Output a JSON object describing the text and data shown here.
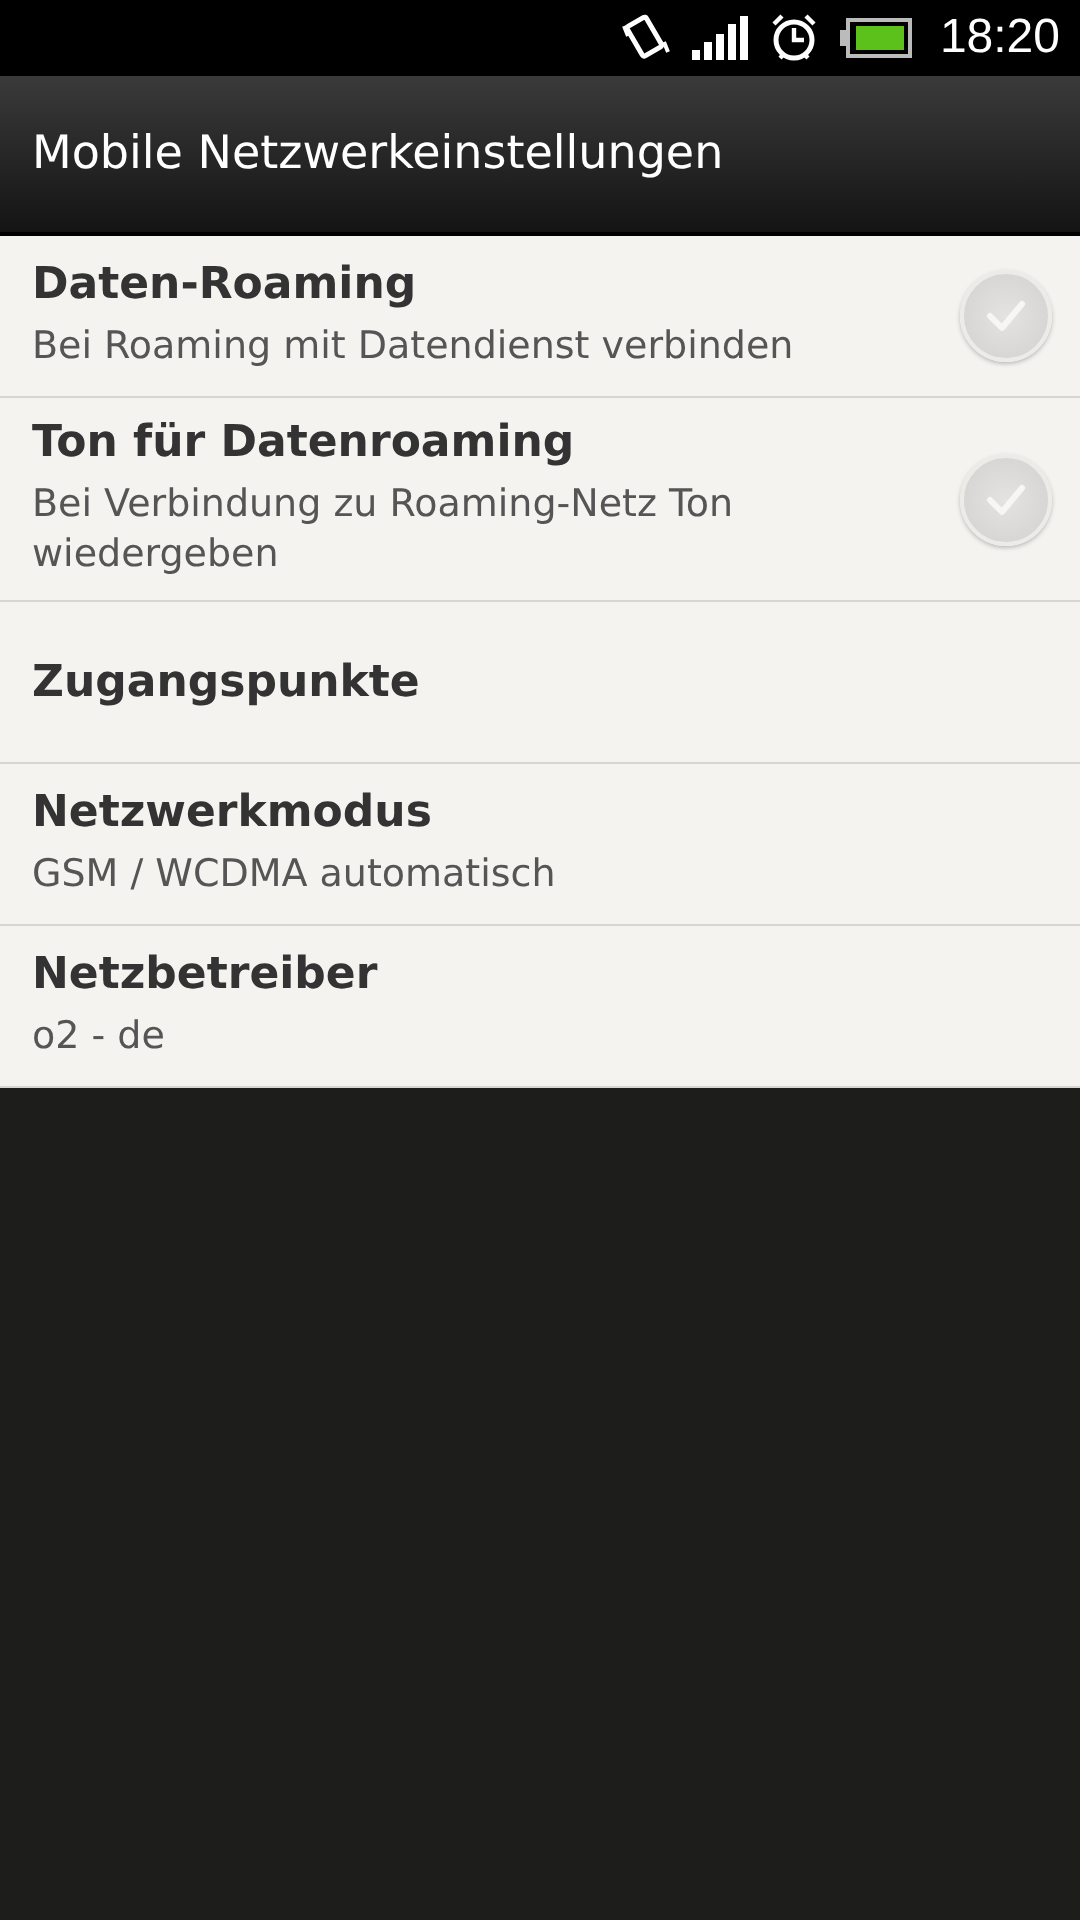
{
  "status_bar": {
    "time": "18:20"
  },
  "title_bar": {
    "title": "Mobile Netzwerkeinstellungen"
  },
  "settings": [
    {
      "kind": "checkbox",
      "title": "Daten-Roaming",
      "summary": "Bei Roaming mit Datendienst verbinden",
      "checked": false
    },
    {
      "kind": "checkbox",
      "title": "Ton für Datenroaming",
      "summary": "Bei Verbindung zu Roaming-Netz Ton wiedergeben",
      "checked": false
    },
    {
      "kind": "text",
      "title": "Zugangspunkte"
    },
    {
      "kind": "text",
      "title": "Netzwerkmodus",
      "summary": "GSM / WCDMA automatisch"
    },
    {
      "kind": "text",
      "title": "Netzbetreiber",
      "summary": "o2 - de"
    }
  ]
}
